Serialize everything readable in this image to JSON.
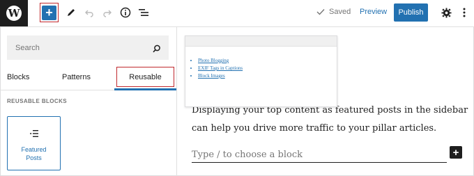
{
  "toolbar": {
    "saved_label": "Saved",
    "preview_label": "Preview",
    "publish_label": "Publish",
    "add_label": "+",
    "accent_color": "#2271b1"
  },
  "inserter": {
    "search_placeholder": "Search",
    "tabs": [
      {
        "label": "Blocks"
      },
      {
        "label": "Patterns"
      },
      {
        "label": "Reusable",
        "active": true
      }
    ],
    "section_heading": "REUSABLE BLOCKS",
    "blocks": [
      {
        "label": "Featured Posts",
        "icon": "list-icon"
      }
    ]
  },
  "editor": {
    "preview_links": [
      "Photo Blogging",
      "EXIF Tags in Captions",
      "Block Images"
    ],
    "paragraph": "Displaying your top content as featured posts in the sidebar can help you drive more traffic to your pillar articles.",
    "appender_placeholder": "Type / to choose a block",
    "appender_add_label": "+"
  }
}
